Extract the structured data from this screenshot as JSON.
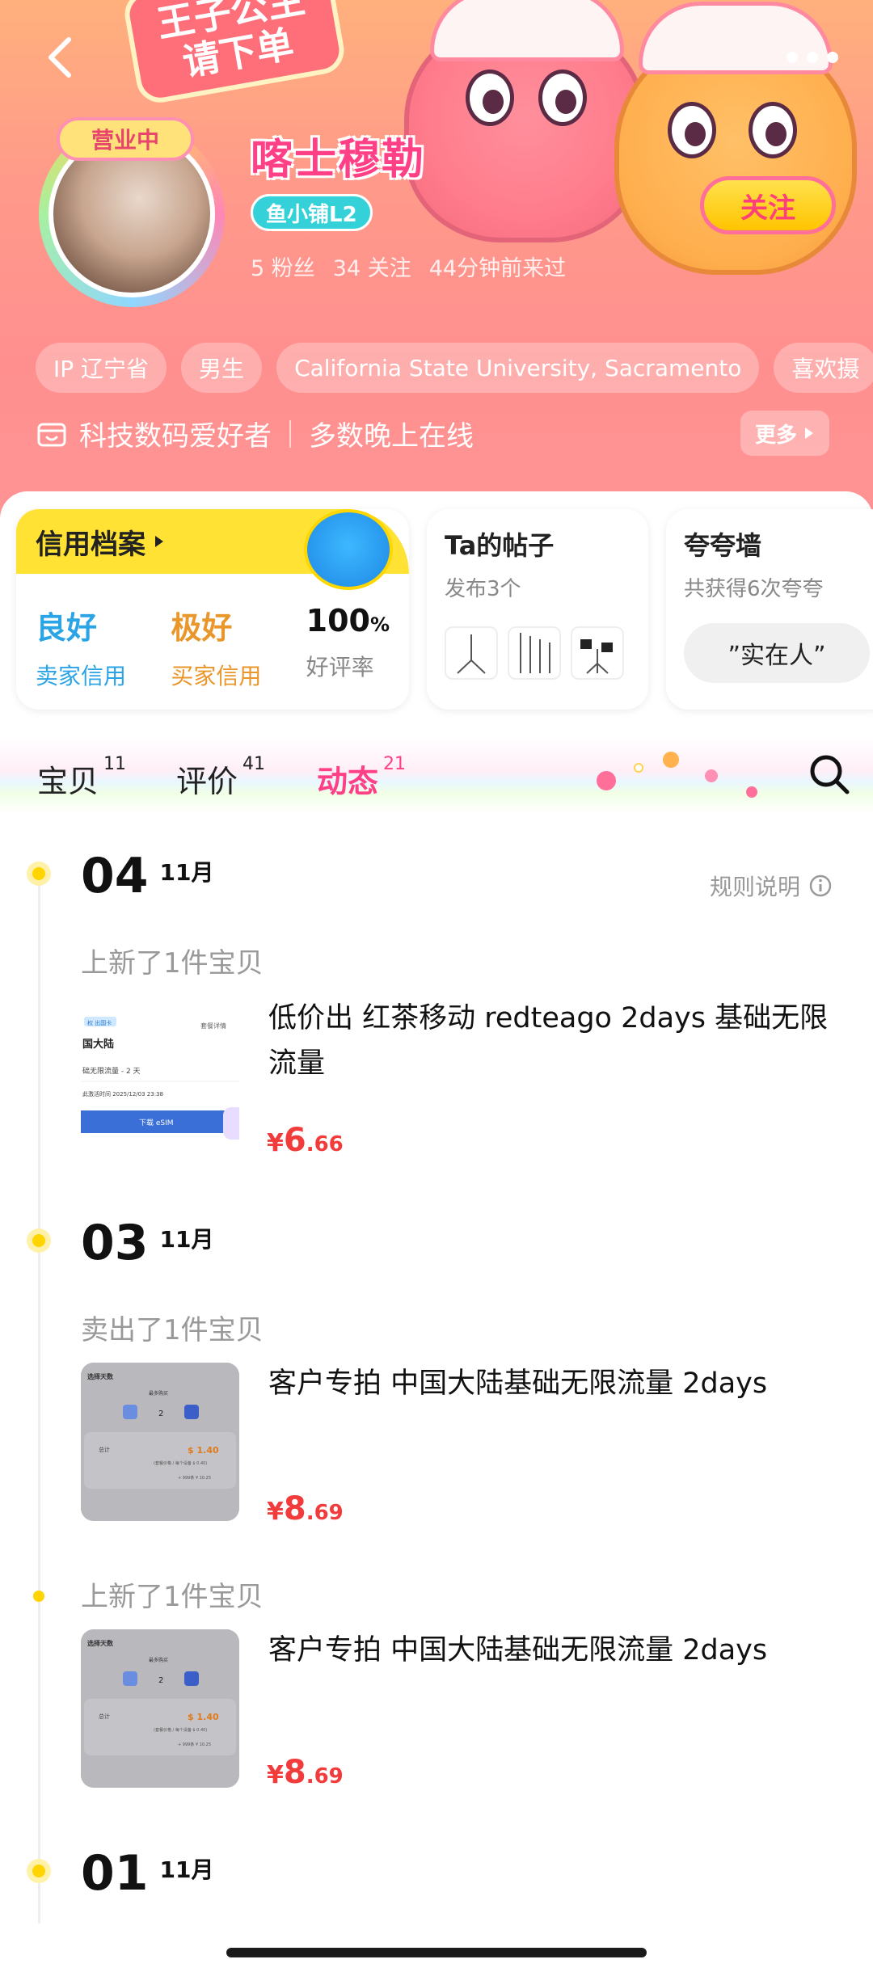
{
  "header": {
    "promo_line1": "王子公主",
    "promo_line2": "请下单",
    "open_status": "营业中",
    "shop_name": "喀士穆勒",
    "level": "鱼小铺L2",
    "fans": "5 粉丝",
    "following": "34 关注",
    "last_seen": "44分钟前来过",
    "follow_label": "关注",
    "tags": [
      "IP 辽宁省",
      "男生",
      "California State University, Sacramento",
      "喜欢摄"
    ],
    "intro_1": "科技数码爱好者",
    "intro_2": "多数晚上在线",
    "more_label": "更多"
  },
  "cards": {
    "credit_title": "信用档案",
    "seller_value": "良好",
    "seller_label": "卖家信用",
    "buyer_value": "极好",
    "buyer_label": "买家信用",
    "rate_value": "100",
    "rate_unit": "%",
    "rate_label": "好评率",
    "posts_title": "Ta的帖子",
    "posts_sub": "发布3个",
    "praise_title": "夸夸墙",
    "praise_sub": "共获得6次夸夸",
    "praise_chip": "”实在人”"
  },
  "tabs": [
    {
      "label": "宝贝",
      "count": "11"
    },
    {
      "label": "评价",
      "count": "41"
    },
    {
      "label": "动态",
      "count": "21"
    }
  ],
  "timeline": {
    "rules_label": "规则说明",
    "groups": [
      {
        "day": "04",
        "month": "11月"
      },
      {
        "day": "03",
        "month": "11月"
      },
      {
        "day": "01",
        "month": "11月"
      }
    ],
    "events": [
      {
        "label": "上新了1件宝贝",
        "title": "低价出 红茶移动 redteago 2days 基础无限流量",
        "price_cur": "¥",
        "price_int": "6",
        "price_dec": ".66"
      },
      {
        "label": "卖出了1件宝贝",
        "title": "客户专拍 中国大陆基础无限流量 2days",
        "price_cur": "¥",
        "price_int": "8",
        "price_dec": ".69"
      },
      {
        "label": "上新了1件宝贝",
        "title": "客户专拍 中国大陆基础无限流量 2days",
        "price_cur": "¥",
        "price_int": "8",
        "price_dec": ".69"
      }
    ]
  },
  "thumb1": {
    "tag": "权 出国卡",
    "region": "国大陆",
    "link": "套餐详情",
    "plan": "础无限流量 - 2 天",
    "expiry": "此激活时间 2025/12/03 23:38",
    "button": "下载 eSIM"
  },
  "thumb2": {
    "title": "选择天数",
    "subtitle": "最多购买",
    "qty": "2",
    "total_label": "总计",
    "total": "$ 1.40",
    "note": "(套餐价格 / 每个设备 $ 0.40)",
    "sub_total": "+ 999条 ¥ 10.25"
  },
  "colors": {
    "accent": "#ff3f86",
    "price": "#f23c3c",
    "timeline_dot": "#ffd400",
    "brand_yellow": "#ffe233"
  }
}
